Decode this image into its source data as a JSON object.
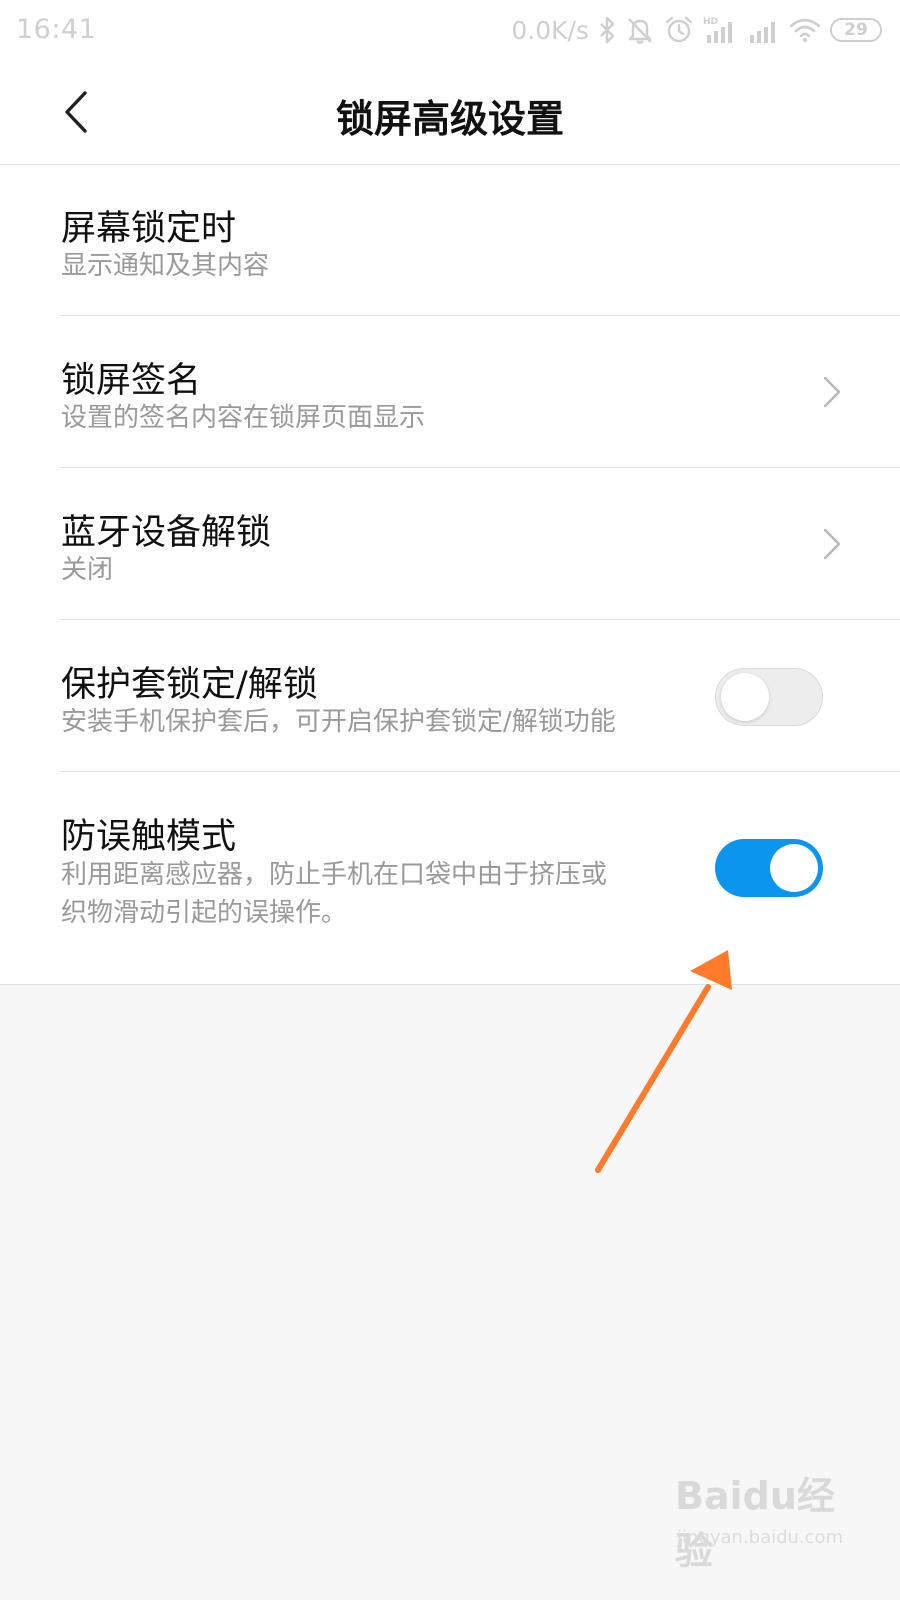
{
  "status_bar": {
    "time": "16:41",
    "network_speed": "0.0K/s",
    "battery": "29",
    "icons": [
      "bluetooth-icon",
      "mute-icon",
      "alarm-icon",
      "hd-signal-icon",
      "signal-icon",
      "wifi-icon",
      "battery-icon"
    ]
  },
  "header": {
    "title": "锁屏高级设置",
    "back_icon": "chevron-left-icon"
  },
  "settings": [
    {
      "title": "屏幕锁定时",
      "subtitle": "显示通知及其内容",
      "control": "none"
    },
    {
      "title": "锁屏签名",
      "subtitle": "设置的签名内容在锁屏页面显示",
      "control": "chevron"
    },
    {
      "title": "蓝牙设备解锁",
      "subtitle": "关闭",
      "control": "chevron"
    },
    {
      "title": "保护套锁定/解锁",
      "subtitle": "安装手机保护套后，可开启保护套锁定/解锁功能",
      "control": "toggle",
      "enabled": false
    },
    {
      "title": "防误触模式",
      "subtitle_line1": "利用距离感应器，防止手机在口袋中由于挤压或",
      "subtitle_line2": "织物滑动引起的误操作。",
      "control": "toggle",
      "enabled": true
    }
  ],
  "annotation": {
    "arrow_color": "#ff7a2a"
  },
  "watermark": {
    "logo": "Baidu经验",
    "url": "jingyan.baidu.com"
  },
  "colors": {
    "toggle_on": "#0b95ef",
    "toggle_off": "#ededed",
    "subtitle": "#9a9a9a",
    "background": "#f7f7f7"
  }
}
